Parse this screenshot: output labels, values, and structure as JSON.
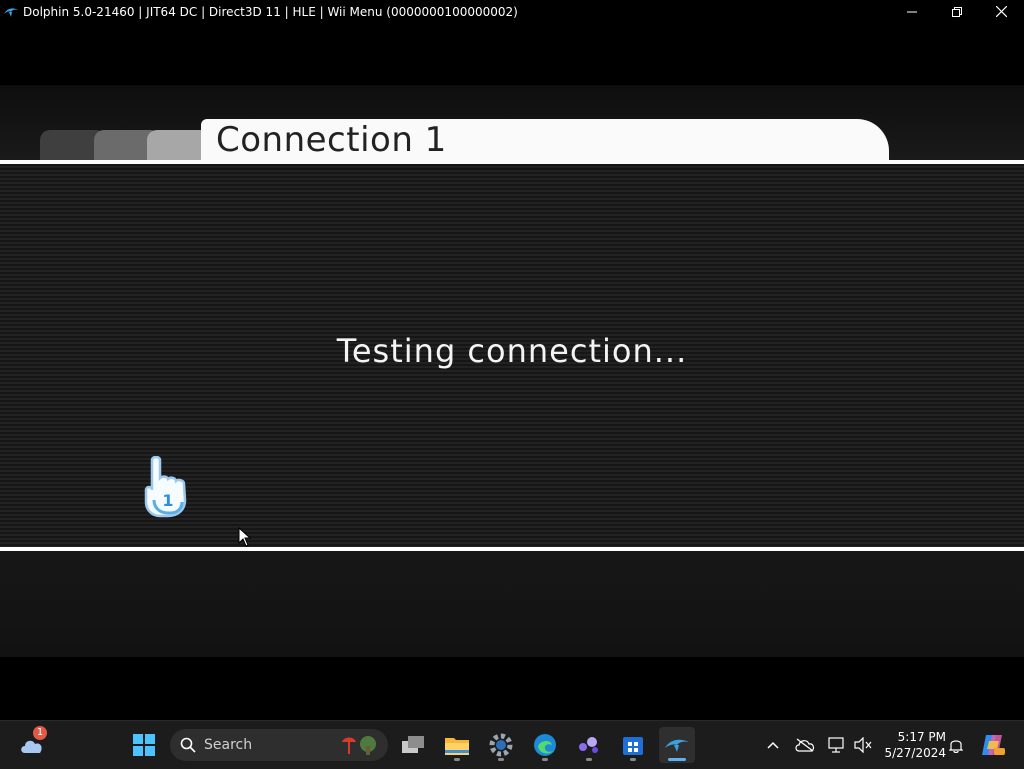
{
  "window": {
    "title": "Dolphin 5.0-21460 | JIT64 DC | Direct3D 11 | HLE | Wii Menu (0000000100000002)",
    "icon": "dolphin-icon",
    "controls": [
      "minimize-icon",
      "restore-icon",
      "close-icon"
    ]
  },
  "game": {
    "tab_title": "Connection 1",
    "message": "Testing connection...",
    "pointer_player": "1",
    "colors": {
      "background": "#000000",
      "tab": "#fafafa",
      "line": "#ffffff"
    }
  },
  "taskbar": {
    "weather_badge": "1",
    "search_label": "Search",
    "apps": [
      "windows-start-icon",
      "task-view-icon",
      "file-explorer-icon",
      "settings-icon",
      "edge-icon",
      "app-icon",
      "store-icon",
      "dolphin-icon"
    ],
    "tray_icons": [
      "chevron-up-icon",
      "onedrive-offline-icon",
      "network-icon",
      "volume-muted-icon"
    ],
    "time": "5:17 PM",
    "date": "5/27/2024",
    "accent": "#5fb2f2"
  }
}
